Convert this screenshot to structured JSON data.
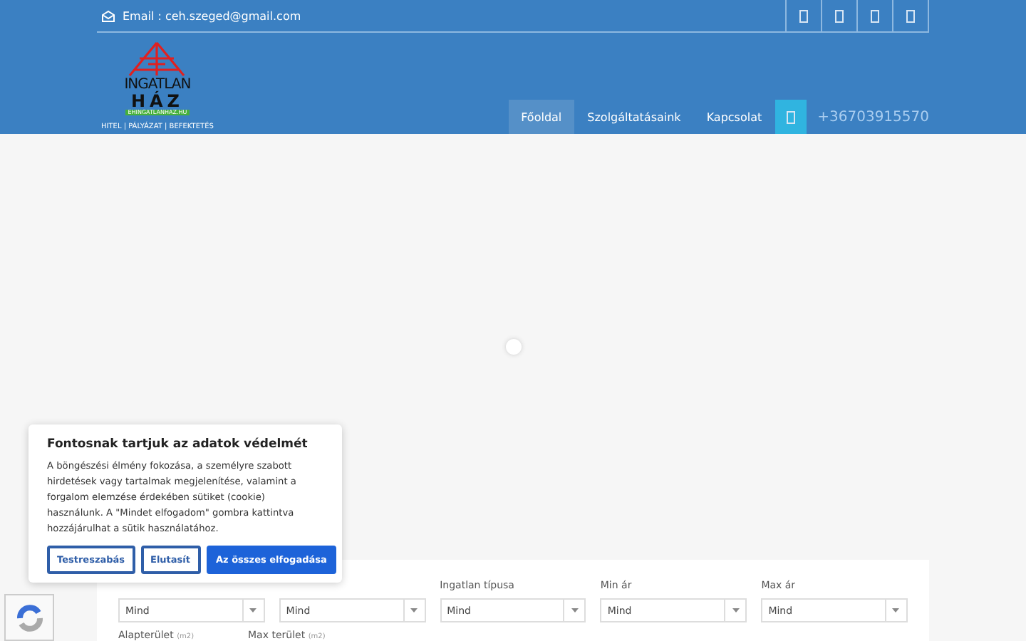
{
  "topbar": {
    "email": "Email : ceh.szeged@gmail.com",
    "socials": [
      {
        "kind": "link"
      },
      {
        "kind": "link"
      },
      {
        "kind": "link"
      },
      {
        "kind": "link"
      }
    ]
  },
  "logo": {
    "line1": "INGATLAN",
    "line2": "HÁZ",
    "domain": "EHINGATLANHAZ.HU",
    "tagline": "HITEL | PÁLYÁZAT | BEFEKTETÉS"
  },
  "nav": {
    "items": [
      {
        "label": "Főoldal",
        "selected": true
      },
      {
        "label": "Szolgáltatásaink",
        "selected": false
      },
      {
        "label": "Kapcsolat",
        "selected": false
      }
    ],
    "phone": "+36703915570"
  },
  "search": {
    "fields": [
      {
        "value": "Mind"
      },
      {
        "value": "Mind"
      },
      {
        "label": "Ingatlan típusa",
        "value": "Mind"
      },
      {
        "label": "Min ár",
        "value": "Mind"
      },
      {
        "label": "Max ár",
        "value": "Mind"
      }
    ],
    "row2": [
      {
        "label": "Alapterület",
        "unit": "(m2)"
      },
      {
        "label": "Max terület",
        "unit": "(m2)"
      }
    ]
  },
  "cookie": {
    "title": "Fontosnak tartjuk az adatok védelmét",
    "text": "A böngészési élmény fokozása, a személyre szabott hirdetések vagy tartalmak megjelenítése, valamint a forgalom elemzése érdekében sütiket (cookie) használunk. A \"Mindet elfogadom\" gombra kattintva hozzájárulhat a sütik használatához.",
    "buttons": [
      {
        "label": "Testreszabás",
        "kind": "outline"
      },
      {
        "label": "Elutasít",
        "kind": "outline"
      },
      {
        "label": "Az összes elfogadása",
        "kind": "primary"
      }
    ]
  }
}
